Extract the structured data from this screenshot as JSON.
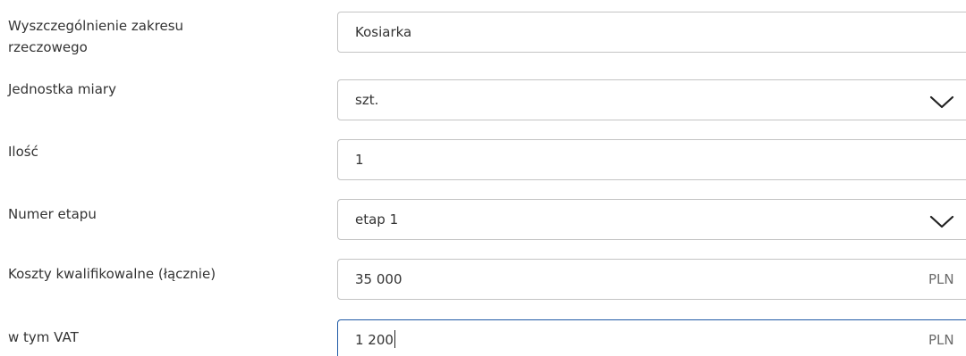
{
  "form": {
    "rows": [
      {
        "label": "Wyszczególnienie zakresu rzeczowego",
        "value": "Kosiarka"
      },
      {
        "label": "Jednostka miary",
        "value": "szt.",
        "icon": "chevron-down-icon"
      },
      {
        "label": "Ilość",
        "value": "1"
      },
      {
        "label": "Numer etapu",
        "value": "etap 1",
        "icon": "chevron-down-icon"
      },
      {
        "label": "Koszty kwalifikowalne (łącznie)",
        "value": "35 000",
        "suffix": "PLN"
      },
      {
        "label": "w tym VAT",
        "value": "1 200",
        "suffix": "PLN"
      }
    ]
  },
  "colors": {
    "border": "#c4c4c4",
    "focus_border": "#1f5aa6",
    "text": "#333333"
  }
}
